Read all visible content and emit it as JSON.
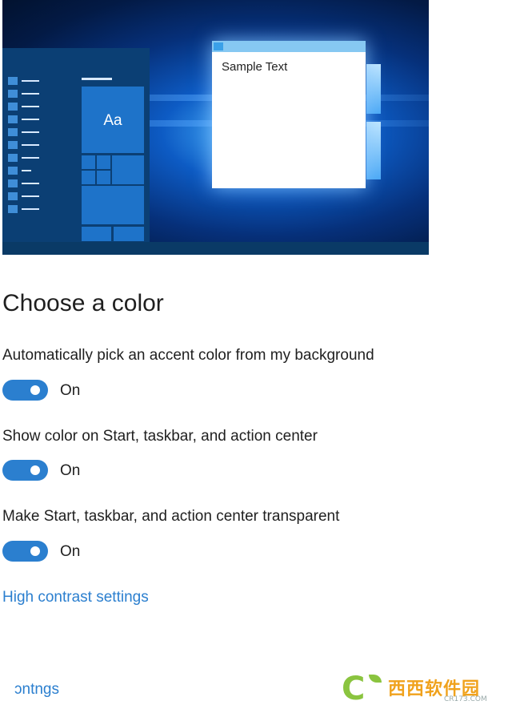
{
  "preview": {
    "sample_text": "Sample Text",
    "tile_label": "Aa",
    "colors": {
      "accent": "#1e73c9",
      "desktop": "#0d5bc4",
      "start_panel": "#0b3f74"
    }
  },
  "section": {
    "title": "Choose a color"
  },
  "settings": [
    {
      "label": "Automatically pick an accent color from my background",
      "state": "On"
    },
    {
      "label": "Show color on Start, taskbar, and action center",
      "state": "On"
    },
    {
      "label": "Make Start, taskbar, and action center transparent",
      "state": "On"
    }
  ],
  "links": {
    "high_contrast": "High contrast settings",
    "bottom_partial": "ɔntngs"
  },
  "watermark": {
    "brand": "西西软件园",
    "url": "CR173.COM"
  },
  "colors": {
    "toggle_on": "#2b7fcf",
    "link": "#2b7fcf"
  }
}
